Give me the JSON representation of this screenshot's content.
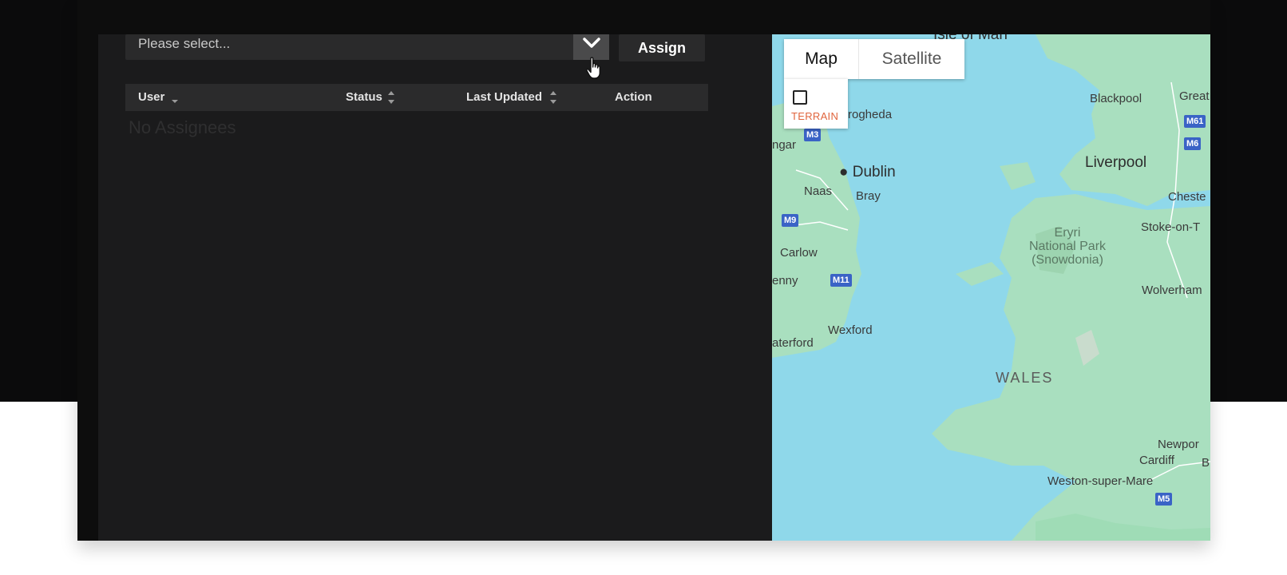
{
  "assign": {
    "select_placeholder": "Please select...",
    "button_label": "Assign"
  },
  "table": {
    "columns": [
      "User",
      "Status",
      "Last Updated",
      "Action"
    ],
    "empty_message": "No Assignees"
  },
  "map": {
    "type_control": {
      "map_label": "Map",
      "satellite_label": "Satellite",
      "selected": "Map"
    },
    "terrain_label": "TERRAIN",
    "terrain_checked": false,
    "places": {
      "isle": "Isle of Man",
      "drogheda": "rogheda",
      "ngar": "ngar",
      "dublin": "Dublin",
      "naas": "Naas",
      "bray": "Bray",
      "carlow": "Carlow",
      "enny": "enny",
      "wexford": "Wexford",
      "waterford": "aterford",
      "blackpool": "Blackpool",
      "great": "Great",
      "liverpool": "Liverpool",
      "chester": "Cheste",
      "stoke": "Stoke-on-T",
      "eryri_1": "Eryri",
      "eryri_2": "National Park",
      "eryri_3": "(Snowdonia)",
      "wolverhampton": "Wolverham",
      "wales": "WALES",
      "newport": "Newpor",
      "cardiff": "Cardiff",
      "bristol": "B",
      "weston": "Weston-super-Mare"
    },
    "shields": {
      "m3": "M3",
      "m9": "M9",
      "m11": "M11",
      "m61": "M61",
      "m6": "M6",
      "m5": "M5"
    },
    "colors": {
      "water": "#8fd8ea",
      "land": "#a9dfbf",
      "terrain_label": "#e0643c"
    }
  }
}
